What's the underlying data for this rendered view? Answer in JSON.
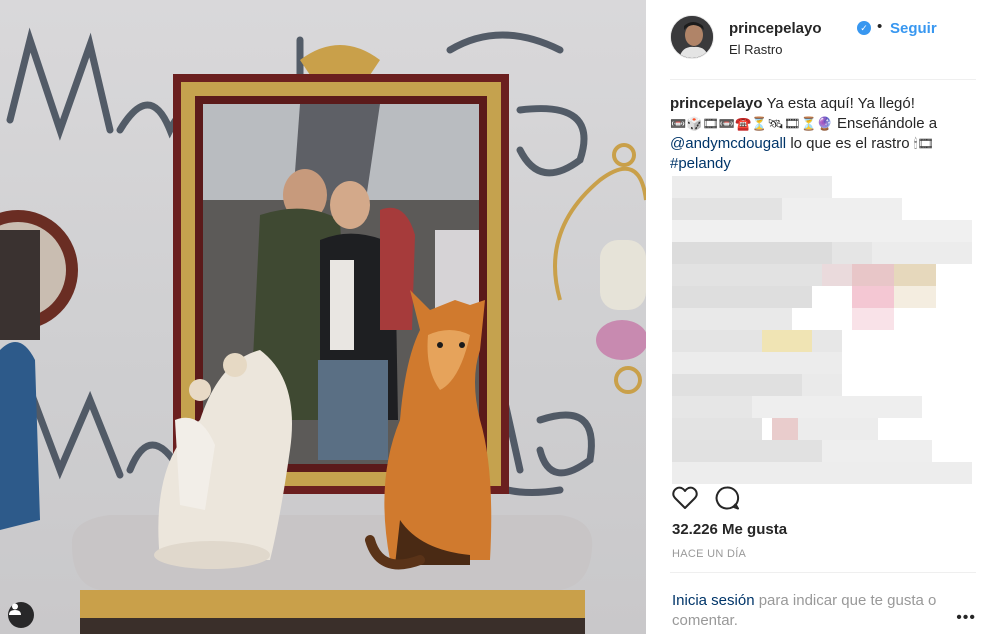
{
  "post": {
    "username": "princepelayo",
    "follow_label": "Seguir",
    "separator": "•",
    "location": "El Rastro"
  },
  "caption": {
    "username": "princepelayo",
    "text_1": "Ya esta aquí! Ya llegó!",
    "emojis_1": "📼🎲🎞📼☎️⏳🛰🎞⏳🔮",
    "text_2": "Enseñándole a",
    "mention": "@andymcdougall",
    "text_3": "lo que es el rastro",
    "emojis_2": "🕯🎞",
    "hashtag": "#pelandy"
  },
  "actions": {
    "like_icon": "heart-icon",
    "comment_icon": "comment-icon"
  },
  "likes": "32.226 Me gusta",
  "timestamp": "HACE UN DÍA",
  "login_prompt": {
    "link": "Inicia sesión",
    "text": "para indicar que te gusta o comentar.",
    "more": "•••"
  },
  "colors": {
    "link_blue": "#3897f0",
    "mention_blue": "#003569",
    "muted_gray": "#999999"
  }
}
